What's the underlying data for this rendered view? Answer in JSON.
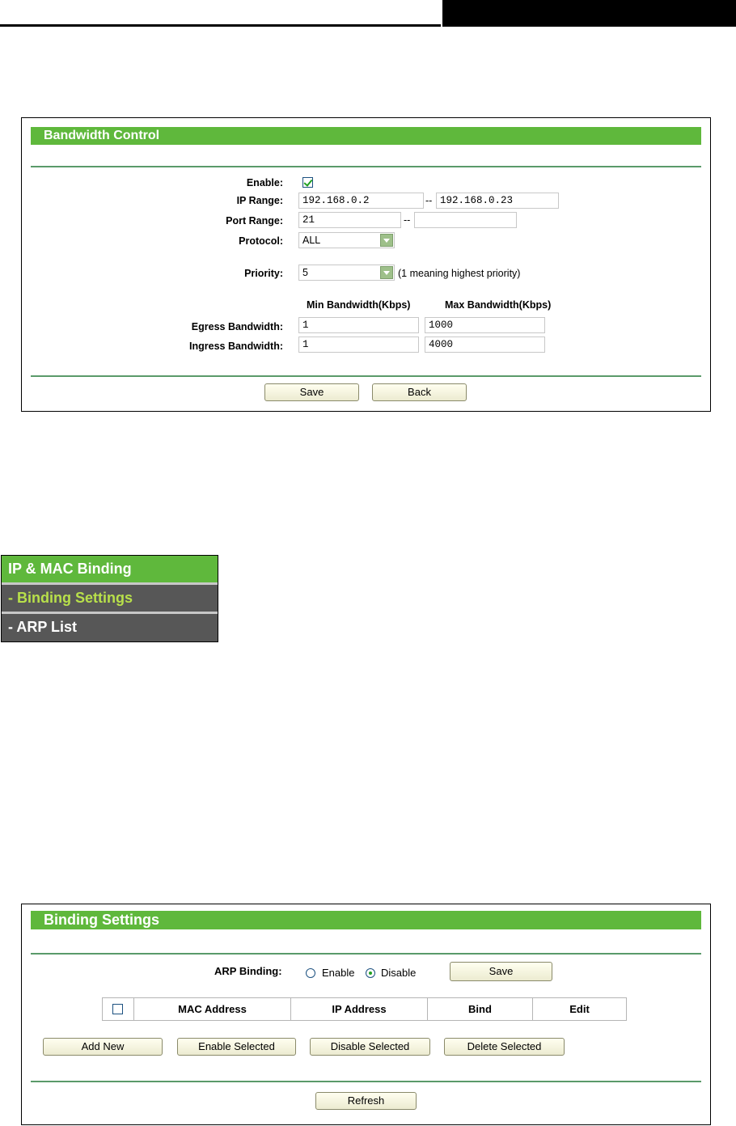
{
  "bandwidth": {
    "title": "Bandwidth Control",
    "enable_label": "Enable:",
    "enable_checked": true,
    "ip_range_label": "IP Range:",
    "ip_start": "192.168.0.2",
    "ip_end": "192.168.0.23",
    "port_range_label": "Port Range:",
    "port_start": "21",
    "port_end": "",
    "range_sep": "--",
    "protocol_label": "Protocol:",
    "protocol_value": "ALL",
    "priority_label": "Priority:",
    "priority_value": "5",
    "priority_hint": "(1 meaning highest priority)",
    "min_header": "Min Bandwidth(Kbps)",
    "max_header": "Max Bandwidth(Kbps)",
    "egress_label": "Egress Bandwidth:",
    "egress_min": "1",
    "egress_max": "1000",
    "ingress_label": "Ingress Bandwidth:",
    "ingress_min": "1",
    "ingress_max": "4000",
    "save_label": "Save",
    "back_label": "Back"
  },
  "menu": {
    "header": "IP & MAC Binding",
    "items": [
      {
        "label": "- Binding Settings",
        "active": true
      },
      {
        "label": "- ARP List",
        "active": false
      }
    ]
  },
  "binding": {
    "title": "Binding Settings",
    "arp_label": "ARP Binding:",
    "enable_label": "Enable",
    "disable_label": "Disable",
    "selected": "Disable",
    "save_label": "Save",
    "columns": [
      "MAC Address",
      "IP Address",
      "Bind",
      "Edit"
    ],
    "add_new_label": "Add New",
    "enable_selected_label": "Enable Selected",
    "disable_selected_label": "Disable Selected",
    "delete_selected_label": "Delete Selected",
    "refresh_label": "Refresh"
  },
  "colors": {
    "accent_green": "#5fb83c",
    "menu_bg": "#575757",
    "menu_active_text": "#b8e04a"
  }
}
